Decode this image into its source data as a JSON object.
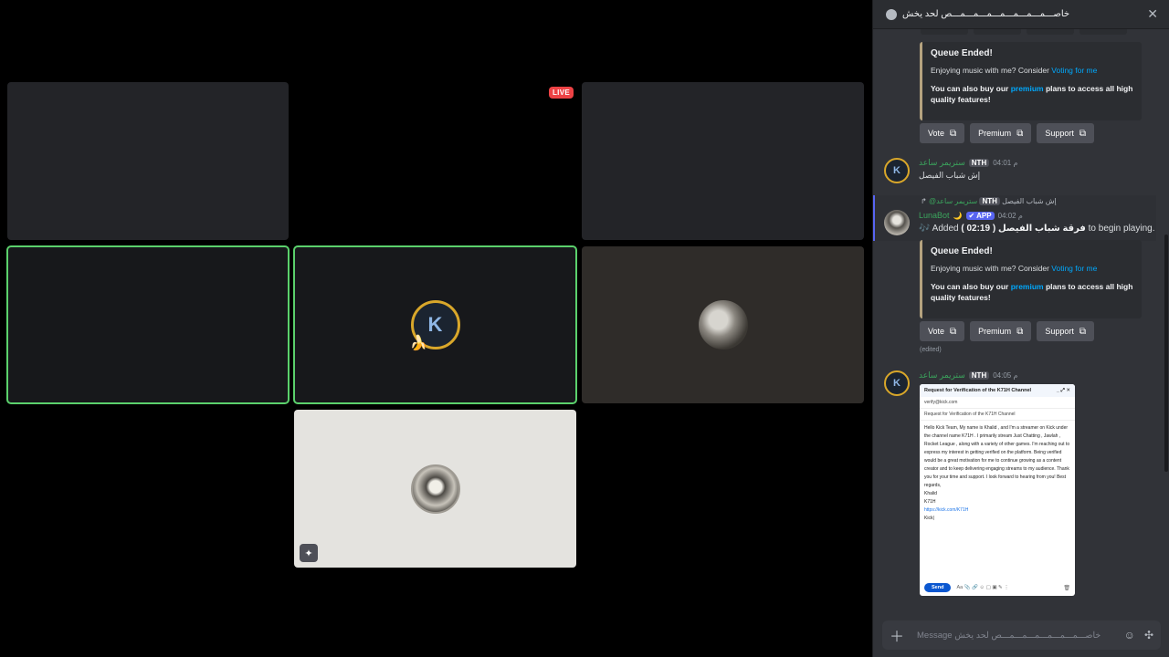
{
  "stage": {
    "live_label": "LIVE",
    "tiles": [
      {
        "name": "tile-empty-1"
      },
      {
        "name": "tile-empty-2"
      },
      {
        "name": "tile-empty-3"
      },
      {
        "name": "tile-speaking-1"
      },
      {
        "name": "tile-k-avatar",
        "avatar_letter": "K"
      },
      {
        "name": "tile-moon-avatar"
      },
      {
        "name": "tile-hood-avatar"
      }
    ]
  },
  "chat": {
    "title": "خاصـــمـــمـــمـــمـــمـــمـــمـــص لحد يخش",
    "messages": [
      {
        "type": "embed",
        "title": "Queue Ended!",
        "line1_prefix": "Enjoying music with me? Consider ",
        "line1_link": "Voting for me",
        "line2_prefix": "You can also buy our ",
        "line2_link": "premium",
        "line2_suffix": " plans to access all high quality features!",
        "buttons": [
          "Vote",
          "Premium",
          "Support"
        ]
      },
      {
        "author": "ستريمر ساعد",
        "tag": "NTH",
        "time": "04:01 م",
        "text": "إش شباب الفيصل"
      },
      {
        "reply_name": "@ستريمر ساعد",
        "reply_tag": "NTH",
        "reply_text": "إش شباب الفيصل",
        "author": "LunaBot",
        "moon": "🌙",
        "app_tag": "APP",
        "time": "04:02 م",
        "text_prefix": "🎶 Added ",
        "text_bold": "( 02:19 ) فرقة شباب الفيصل",
        "text_suffix": " to begin playing.",
        "embed_title": "Queue Ended!",
        "embed_line1_prefix": "Enjoying music with me? Consider ",
        "embed_line1_link": "Voting for me",
        "embed_line2_prefix": "You can also buy our ",
        "embed_line2_link": "premium",
        "embed_line2_suffix": " plans to access all high quality features!",
        "buttons": [
          "Vote",
          "Premium",
          "Support"
        ],
        "edited": "(edited)"
      },
      {
        "author": "ستريمر ساعد",
        "tag": "NTH",
        "time": "04:05 م",
        "attachment": {
          "window_title": "Request for Verification of the K71H Channel",
          "to": "verify@kick.com",
          "subject": "Request for Verification of the K71H Channel",
          "body": "Hello Kick Team, My name is Khalid , and I'm a streamer on Kick under the channel name K71H . I primarily stream Just Chatting , Jawlah , Rocket League , along with a variety of other games. I'm reaching out to express my interest in getting verified on the platform. Being verified would be a great motivation for me to continue growing as a content creator and to keep delivering engaging streams to my audience. Thank you for your time and support. I look forward to hearing from you! Best regards,",
          "sig1": "Khalid",
          "sig2": "K71H",
          "link": "https://kick.com/K71H",
          "sig3": "Kick|",
          "send_label": "Send"
        }
      }
    ],
    "composer_placeholder": "Message خاصـــمـــمـــمـــمـــمـــمـــص لحد يخش"
  }
}
